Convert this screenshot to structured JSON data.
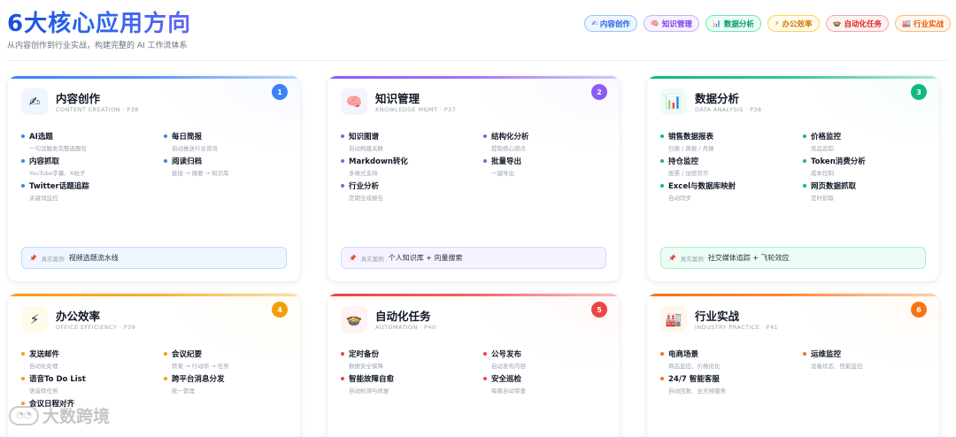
{
  "header": {
    "title": "6大核心应用方向",
    "subtitle": "从内容创作到行业实战，构建完整的 AI 工作流体系"
  },
  "pills": [
    {
      "icon": "✍",
      "label": "内容创作",
      "color": "#2563eb",
      "bg": "#eff6ff",
      "border": "#93c5fd"
    },
    {
      "icon": "🧠",
      "label": "知识管理",
      "color": "#7c3aed",
      "bg": "#f5f3ff",
      "border": "#c4b5fd"
    },
    {
      "icon": "📊",
      "label": "数据分析",
      "color": "#059669",
      "bg": "#ecfdf5",
      "border": "#6ee7b7"
    },
    {
      "icon": "⚡",
      "label": "办公效率",
      "color": "#d97706",
      "bg": "#fffbeb",
      "border": "#fcd34d"
    },
    {
      "icon": "🍲",
      "label": "自动化任务",
      "color": "#dc2626",
      "bg": "#fef2f2",
      "border": "#fca5a5"
    },
    {
      "icon": "🏭",
      "label": "行业实战",
      "color": "#ea580c",
      "bg": "#fff7ed",
      "border": "#fdba74"
    }
  ],
  "cards": [
    {
      "number": "1",
      "icon": "✍",
      "title": "内容创作",
      "subtitle": "CONTENT CREATION · P38",
      "color": "#3b82f6",
      "icon_bg": "#eff6ff",
      "items": [
        {
          "name": "AI选题",
          "desc": "一句话触发完整选题包"
        },
        {
          "name": "每日简报",
          "desc": "自动推送行业资讯"
        },
        {
          "name": "内容抓取",
          "desc": "YouTube字幕、X帖子"
        },
        {
          "name": "阅读归档",
          "desc": "链接 → 摘要 → 知识库"
        },
        {
          "name": "Twitter话题追踪",
          "desc": "关键词监控"
        }
      ],
      "case_tag": "真实案例",
      "case_text": "视频选题流水线",
      "case_bg": "#eff6ff",
      "case_border": "#bfdbfe"
    },
    {
      "number": "2",
      "icon": "🧠",
      "title": "知识管理",
      "subtitle": "KNOWLEDGE MGMT · P37",
      "color": "#8b5cf6",
      "icon_bg": "#f5f3ff",
      "items": [
        {
          "name": "知识图谱",
          "desc": "自动构建关联"
        },
        {
          "name": "结构化分析",
          "desc": "提取核心观点"
        },
        {
          "name": "Markdown转化",
          "desc": "多格式支持"
        },
        {
          "name": "批量导出",
          "desc": "一键导出"
        },
        {
          "name": "行业分析",
          "desc": "定期生成报告"
        }
      ],
      "case_tag": "真实案例",
      "case_text": "个人知识库 + 向量搜索",
      "case_bg": "#f5f3ff",
      "case_border": "#ddd6fe"
    },
    {
      "number": "3",
      "icon": "📊",
      "title": "数据分析",
      "subtitle": "DATA ANALYSIS · P38",
      "color": "#10b981",
      "icon_bg": "#ecfdf5",
      "items": [
        {
          "name": "销售数据报表",
          "desc": "日报 / 周报 / 月报"
        },
        {
          "name": "价格监控",
          "desc": "竞品追踪"
        },
        {
          "name": "持仓监控",
          "desc": "股票 / 加密货币"
        },
        {
          "name": "Token消费分析",
          "desc": "成本控制"
        },
        {
          "name": "Excel与数据库映射",
          "desc": "自动同步"
        },
        {
          "name": "网页数据抓取",
          "desc": "定时抓取"
        }
      ],
      "case_tag": "真实案例",
      "case_text": "社交媒体追踪 + 飞轮效应",
      "case_bg": "#ecfdf5",
      "case_border": "#a7f3d0"
    },
    {
      "number": "4",
      "icon": "⚡",
      "title": "办公效率",
      "subtitle": "OFFICE EFFICIENCY · P39",
      "color": "#f59e0b",
      "icon_bg": "#fffbeb",
      "items": [
        {
          "name": "发送邮件",
          "desc": "自动化处理"
        },
        {
          "name": "会议纪要",
          "desc": "转录 → 行动项 → 任务"
        },
        {
          "name": "语音To Do List",
          "desc": "语音转任务"
        },
        {
          "name": "跨平台消息分发",
          "desc": "统一管理"
        },
        {
          "name": "会议日程对齐",
          "desc": ""
        }
      ],
      "case_tag": "",
      "case_text": "",
      "case_bg": "",
      "case_border": ""
    },
    {
      "number": "5",
      "icon": "🍲",
      "title": "自动化任务",
      "subtitle": "AUTOMATION · P40",
      "color": "#ef4444",
      "icon_bg": "#fef2f2",
      "items": [
        {
          "name": "定时备份",
          "desc": "数据安全保障"
        },
        {
          "name": "公号发布",
          "desc": "自动发布内容"
        },
        {
          "name": "智能故障自愈",
          "desc": "自动检测与修复"
        },
        {
          "name": "安全巡检",
          "desc": "每晚自动审查"
        }
      ],
      "case_tag": "",
      "case_text": "",
      "case_bg": "",
      "case_border": ""
    },
    {
      "number": "6",
      "icon": "🏭",
      "title": "行业实战",
      "subtitle": "INDUSTRY PRACTICE · P41",
      "color": "#f97316",
      "icon_bg": "#fff7ed",
      "items": [
        {
          "name": "电商场景",
          "desc": "商品监控、价格优化"
        },
        {
          "name": "运维监控",
          "desc": "设备状态、性能监控"
        },
        {
          "name": "24/7 智能客服",
          "desc": "自动回复、全天候服务"
        }
      ],
      "case_tag": "",
      "case_text": "",
      "case_bg": "",
      "case_border": ""
    }
  ],
  "watermark": {
    "text": "大数跨境"
  }
}
